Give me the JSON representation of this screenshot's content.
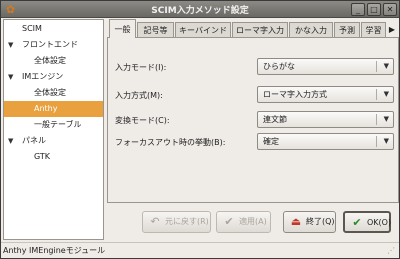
{
  "window": {
    "title": "SCIM入力メソッド設定"
  },
  "tree": {
    "items": [
      {
        "label": "SCIM",
        "expander": ""
      },
      {
        "label": "フロントエンド",
        "expander": "▼"
      },
      {
        "label": "全体設定",
        "expander": ""
      },
      {
        "label": "IMエンジン",
        "expander": "▼"
      },
      {
        "label": "全体設定",
        "expander": ""
      },
      {
        "label": "Anthy",
        "expander": ""
      },
      {
        "label": "一般テーブル",
        "expander": ""
      },
      {
        "label": "パネル",
        "expander": "▼"
      },
      {
        "label": "GTK",
        "expander": ""
      }
    ]
  },
  "tabs": [
    {
      "label": "一般"
    },
    {
      "label": "記号等"
    },
    {
      "label": "キーバインド"
    },
    {
      "label": "ローマ字入力"
    },
    {
      "label": "かな入力"
    },
    {
      "label": "予測"
    },
    {
      "label": "学習"
    }
  ],
  "tab_scroll": "▶",
  "settings": [
    {
      "label": "入力モード(I):",
      "value": "ひらがな"
    },
    {
      "label": "入力方式(M):",
      "value": "ローマ字入力方式"
    },
    {
      "label": "変換モード(C):",
      "value": "連文節"
    },
    {
      "label": "フォーカスアウト時の挙動(B):",
      "value": "確定"
    }
  ],
  "buttons": {
    "revert": {
      "label": "元に戻す(R)",
      "icon": "↶"
    },
    "apply": {
      "label": "適用(A)",
      "icon": "✔"
    },
    "quit": {
      "label": "終了(Q)",
      "icon": "⏏"
    },
    "ok": {
      "label": "OK(O)",
      "icon": "✔"
    }
  },
  "status": {
    "text": "Anthy IMEngineモジュール"
  },
  "colors": {
    "selection": "#e8a13e",
    "ok_icon": "#2a8a2a",
    "quit_icon": "#c0392b"
  }
}
